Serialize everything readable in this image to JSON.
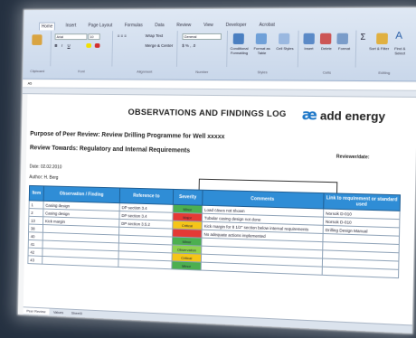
{
  "ribbon": {
    "tabs": [
      "Home",
      "Insert",
      "Page Layout",
      "Formulas",
      "Data",
      "Review",
      "View",
      "Developer",
      "Acrobat"
    ],
    "active_tab": "Home",
    "font_name": "Arial",
    "font_size": "10",
    "wrap_text": "Wrap Text",
    "merge_center": "Merge & Center",
    "number_format": "General",
    "conditional_formatting": "Conditional Formatting",
    "format_as_table": "Format as Table",
    "cell_styles": "Cell Styles",
    "insert": "Insert",
    "delete": "Delete",
    "format": "Format",
    "sort_filter": "Sort & Filter",
    "find_select": "Find & Select",
    "groups": [
      "Clipboard",
      "Font",
      "Alignment",
      "Number",
      "Styles",
      "Cells",
      "Editing"
    ],
    "name_box": "A5"
  },
  "sheet": {
    "title": "OBSERVATIONS AND FINDINGS LOG",
    "logo_mark": "æ",
    "logo_text": "add energy",
    "purpose": "Purpose of Peer Review: Review Drilling Programme for Well xxxxx",
    "towards": "Review Towards: Regulatory and Internal Requirements",
    "reviewer_label": "Reviewer/date:",
    "date": "Date: 02.02.2010",
    "author": "Author: H. Berg",
    "headers": [
      "Item",
      "Observation / Finding",
      "Reference to",
      "Severity",
      "Comments",
      "Link to requirement or standard used"
    ],
    "rows": [
      {
        "item": "1",
        "finding": "Casing design",
        "ref": "DP section 3.4",
        "severity": "Minor",
        "sev": "minor",
        "comment": "Load cases not shown",
        "link": "Norsok D-010"
      },
      {
        "item": "2",
        "finding": "Casing design",
        "ref": "DP section 3.4",
        "severity": "Major",
        "sev": "critical",
        "comment": "Tubular casing design not done",
        "link": "Norsok D-010"
      },
      {
        "item": "13",
        "finding": "Kick margin",
        "ref": "DP section 3.5.2",
        "severity": "Critical",
        "sev": "major",
        "comment": "Kick margin for 8 1/2\" section below internal requirements",
        "link": "Drilling Design Manual"
      },
      {
        "item": "38",
        "finding": "",
        "ref": "",
        "severity": "",
        "sev": "critical",
        "comment": "No adequate actions implemented",
        "link": ""
      },
      {
        "item": "40",
        "finding": "",
        "ref": "",
        "severity": "Minor",
        "sev": "minor",
        "comment": "",
        "link": ""
      },
      {
        "item": "41",
        "finding": "",
        "ref": "",
        "severity": "Observation",
        "sev": "none",
        "comment": "",
        "link": ""
      },
      {
        "item": "42",
        "finding": "",
        "ref": "",
        "severity": "Critical",
        "sev": "major",
        "comment": "",
        "link": ""
      },
      {
        "item": "43",
        "finding": "",
        "ref": "",
        "severity": "Minor",
        "sev": "minor",
        "comment": "",
        "link": ""
      }
    ],
    "sheet_tabs": [
      "Peer Review",
      "Values",
      "Sheet3"
    ]
  },
  "colors": {
    "header_blue": "#2f8dd6",
    "critical": "#e53935",
    "major": "#f5c518",
    "minor": "#4caf50",
    "logo_blue": "#1f78c8"
  }
}
